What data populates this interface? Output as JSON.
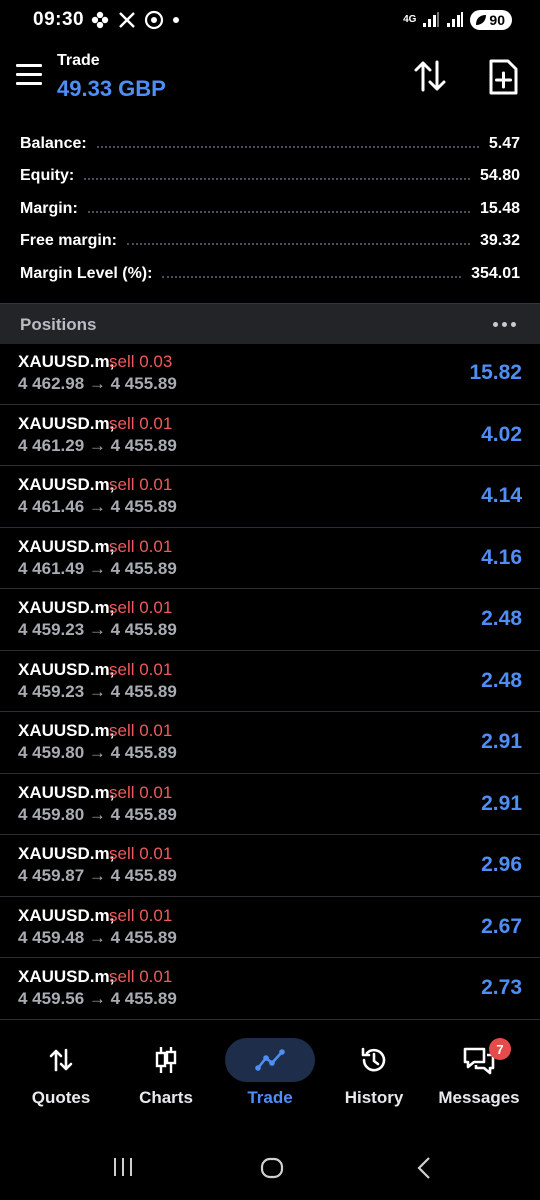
{
  "status_bar": {
    "time": "09:30",
    "network": "4G",
    "battery": "90"
  },
  "header": {
    "title": "Trade",
    "balance_value": "49.33 GBP"
  },
  "summary": [
    {
      "label": "Balance:",
      "value": "5.47"
    },
    {
      "label": "Equity:",
      "value": "54.80"
    },
    {
      "label": "Margin:",
      "value": "15.48"
    },
    {
      "label": "Free margin:",
      "value": "39.32"
    },
    {
      "label": "Margin Level (%):",
      "value": "354.01"
    }
  ],
  "positions": {
    "title": "Positions",
    "rows": [
      {
        "symbol": "XAUUSD.m,",
        "side": "sell 0.03",
        "prices": "4 462.98 → 4 455.89",
        "profit": "15.82"
      },
      {
        "symbol": "XAUUSD.m,",
        "side": "sell 0.01",
        "prices": "4 461.29 → 4 455.89",
        "profit": "4.02"
      },
      {
        "symbol": "XAUUSD.m,",
        "side": "sell 0.01",
        "prices": "4 461.46 → 4 455.89",
        "profit": "4.14"
      },
      {
        "symbol": "XAUUSD.m,",
        "side": "sell 0.01",
        "prices": "4 461.49 → 4 455.89",
        "profit": "4.16"
      },
      {
        "symbol": "XAUUSD.m,",
        "side": "sell 0.01",
        "prices": "4 459.23 → 4 455.89",
        "profit": "2.48"
      },
      {
        "symbol": "XAUUSD.m,",
        "side": "sell 0.01",
        "prices": "4 459.23 → 4 455.89",
        "profit": "2.48"
      },
      {
        "symbol": "XAUUSD.m,",
        "side": "sell 0.01",
        "prices": "4 459.80 → 4 455.89",
        "profit": "2.91"
      },
      {
        "symbol": "XAUUSD.m,",
        "side": "sell 0.01",
        "prices": "4 459.80 → 4 455.89",
        "profit": "2.91"
      },
      {
        "symbol": "XAUUSD.m,",
        "side": "sell 0.01",
        "prices": "4 459.87 → 4 455.89",
        "profit": "2.96"
      },
      {
        "symbol": "XAUUSD.m,",
        "side": "sell 0.01",
        "prices": "4 459.48 → 4 455.89",
        "profit": "2.67"
      },
      {
        "symbol": "XAUUSD.m,",
        "side": "sell 0.01",
        "prices": "4 459.56 → 4 455.89",
        "profit": "2.73"
      }
    ]
  },
  "bottom_nav": [
    {
      "label": "Quotes",
      "icon": "quotes-icon"
    },
    {
      "label": "Charts",
      "icon": "charts-icon"
    },
    {
      "label": "Trade",
      "icon": "trade-icon",
      "active": true
    },
    {
      "label": "History",
      "icon": "history-icon"
    },
    {
      "label": "Messages",
      "icon": "messages-icon",
      "badge": "7"
    }
  ],
  "colors": {
    "accent": "#4f8ff5",
    "sell": "#f05a5a",
    "background": "#000000"
  }
}
